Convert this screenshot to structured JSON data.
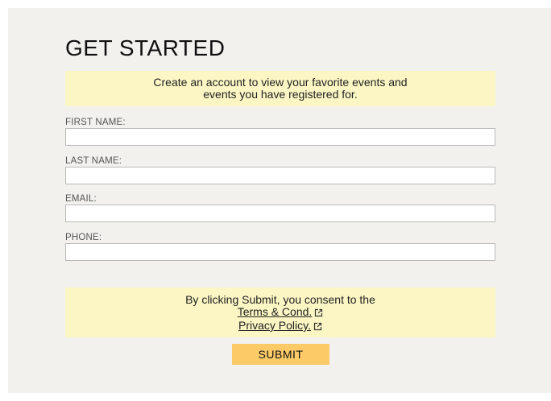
{
  "form": {
    "title": "GET STARTED",
    "intro_line1": "Create an account to view your favorite events and",
    "intro_line2": "events you have registered for.",
    "fields": [
      {
        "label": "FIRST NAME:",
        "value": "",
        "placeholder": ""
      },
      {
        "label": "LAST NAME:",
        "value": "",
        "placeholder": ""
      },
      {
        "label": "EMAIL:",
        "value": "",
        "placeholder": ""
      },
      {
        "label": "PHONE:",
        "value": "",
        "placeholder": ""
      }
    ],
    "consent_text": "By clicking Submit, you consent to the",
    "terms_link": "Terms & Cond.",
    "privacy_link": "Privacy Policy.",
    "submit_label": "SUBMIT"
  },
  "icons": {
    "external_link": "external-link-icon"
  },
  "colors": {
    "panel_background": "#f2f1ee",
    "note_background": "#fbf6c4",
    "submit_background": "#fccb68"
  }
}
